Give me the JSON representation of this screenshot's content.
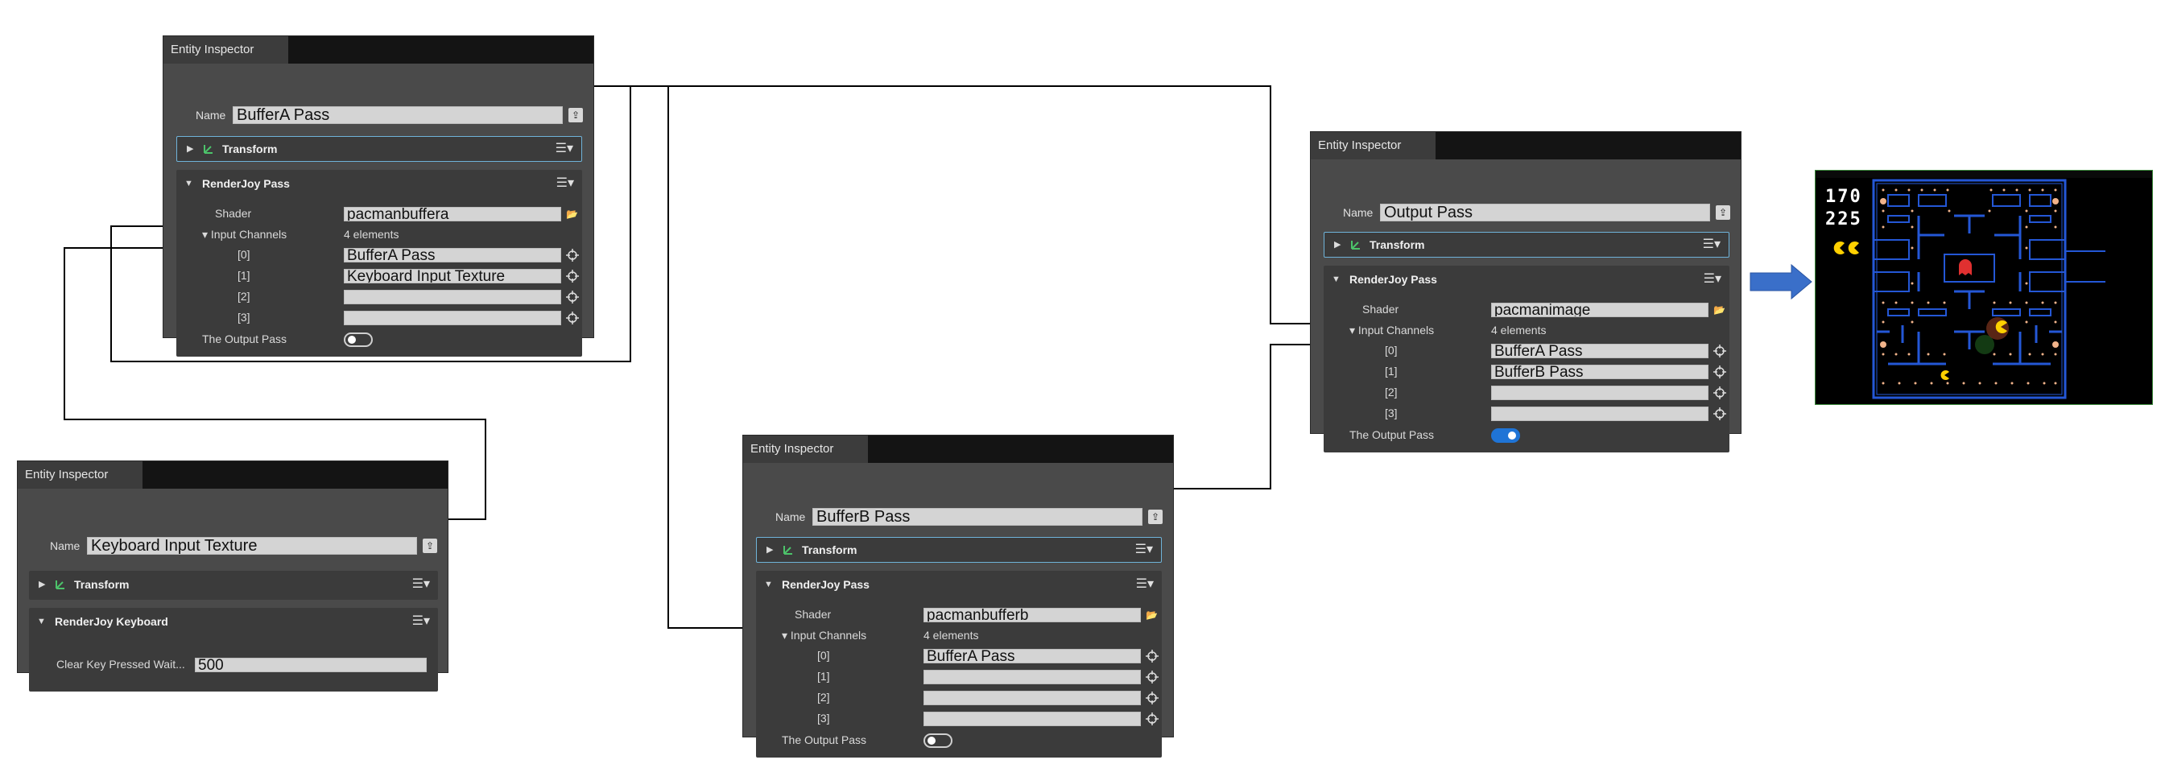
{
  "colors": {
    "panel_bg": "#4a4a4a",
    "header_bg": "#141414",
    "field_bg": "#d4d4d4",
    "accent_blue": "#6fb3d9",
    "toggle_on": "#1f74d6",
    "arrow_blue": "#3a6fc9"
  },
  "inspector_a": {
    "tab": "Entity Inspector",
    "name_label": "Name",
    "name_value": "BufferA Pass",
    "transform": "Transform",
    "component": "RenderJoy Pass",
    "shader_label": "Shader",
    "shader_value": "pacmanbuffera",
    "channels_label": "Input Channels",
    "channels_count": "4 elements",
    "channels": [
      {
        "index": "[0]",
        "value": "BufferA Pass"
      },
      {
        "index": "[1]",
        "value": "Keyboard Input Texture"
      },
      {
        "index": "[2]",
        "value": ""
      },
      {
        "index": "[3]",
        "value": ""
      }
    ],
    "output_label": "The Output Pass",
    "output_on": false
  },
  "inspector_keyboard": {
    "tab": "Entity Inspector",
    "name_label": "Name",
    "name_value": "Keyboard Input Texture",
    "transform": "Transform",
    "component": "RenderJoy Keyboard",
    "clear_label": "Clear Key Pressed Wait...",
    "clear_value": "500"
  },
  "inspector_b": {
    "tab": "Entity Inspector",
    "name_label": "Name",
    "name_value": "BufferB Pass",
    "transform": "Transform",
    "component": "RenderJoy Pass",
    "shader_label": "Shader",
    "shader_value": "pacmanbufferb",
    "channels_label": "Input Channels",
    "channels_count": "4 elements",
    "channels": [
      {
        "index": "[0]",
        "value": "BufferA Pass"
      },
      {
        "index": "[1]",
        "value": ""
      },
      {
        "index": "[2]",
        "value": ""
      },
      {
        "index": "[3]",
        "value": ""
      }
    ],
    "output_label": "The Output Pass",
    "output_on": false
  },
  "inspector_output": {
    "tab": "Entity Inspector",
    "name_label": "Name",
    "name_value": "Output Pass",
    "transform": "Transform",
    "component": "RenderJoy Pass",
    "shader_label": "Shader",
    "shader_value": "pacmanimage",
    "channels_label": "Input Channels",
    "channels_count": "4 elements",
    "channels": [
      {
        "index": "[0]",
        "value": "BufferA Pass"
      },
      {
        "index": "[1]",
        "value": "BufferB Pass"
      },
      {
        "index": "[2]",
        "value": ""
      },
      {
        "index": "[3]",
        "value": ""
      }
    ],
    "output_label": "The Output Pass",
    "output_on": true
  },
  "game": {
    "score": "170",
    "high_score": "225",
    "lives": 2
  }
}
